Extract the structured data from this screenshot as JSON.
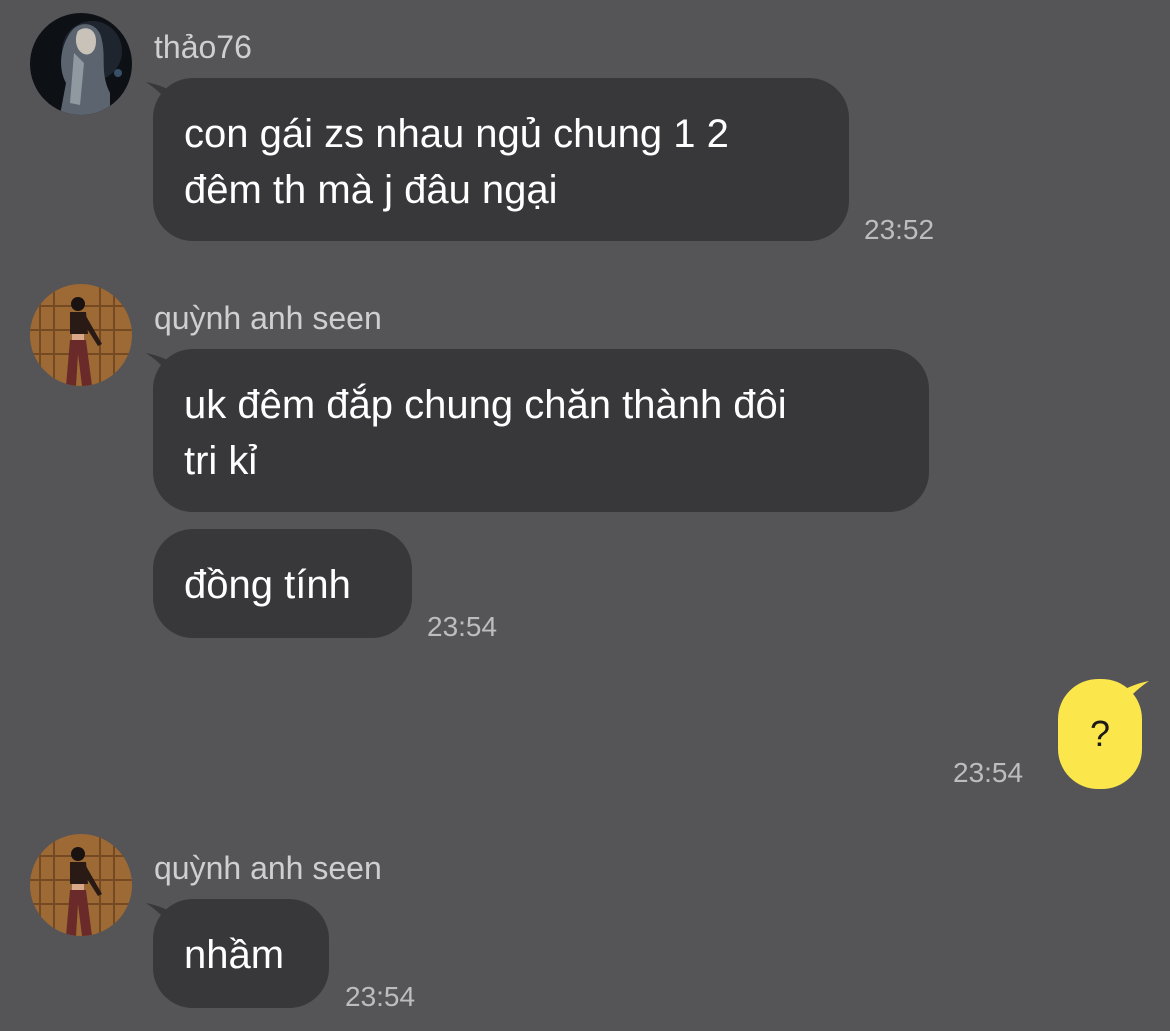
{
  "messages": {
    "m1": {
      "sender": "thảo76",
      "lines": [
        "con gái zs nhau ngủ chung 1 2",
        "đêm th mà j đâu ngại"
      ],
      "time": "23:52"
    },
    "m2": {
      "sender": "quỳnh anh seen",
      "lines": [
        "uk đêm đắp chung chăn thành đôi",
        "tri kỉ"
      ],
      "second_bubble": "đồng tính",
      "time": "23:54"
    },
    "m3": {
      "text": "?",
      "time": "23:54"
    },
    "m4": {
      "sender": "quỳnh anh seen",
      "text": "nhầm",
      "time": "23:54"
    }
  },
  "colors": {
    "background": "#555456",
    "incoming_bubble": "#38383a",
    "outgoing_bubble": "#fbe64c"
  },
  "icons": {
    "avatar_1": "profile-photo-dark-portrait",
    "avatar_2": "profile-photo-warm-wood-wall"
  }
}
